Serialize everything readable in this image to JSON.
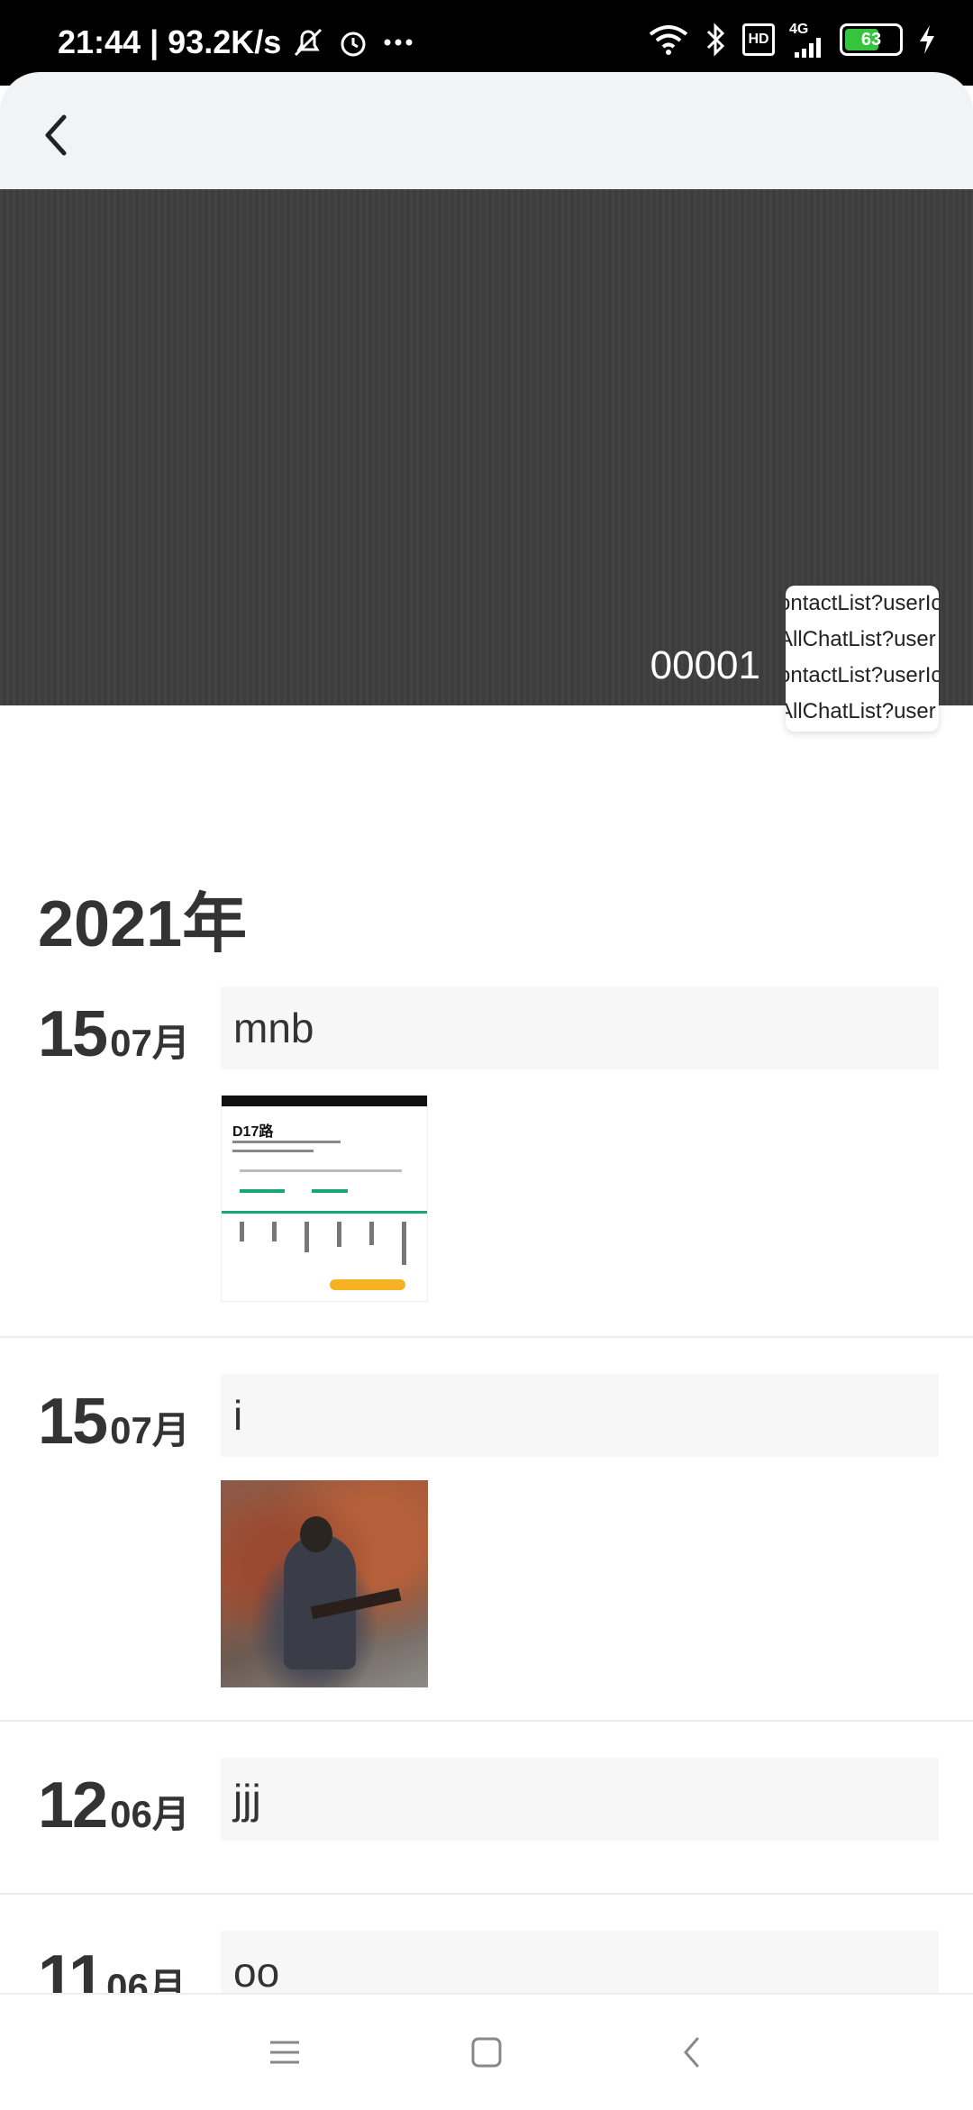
{
  "status_bar": {
    "time": "21:44",
    "speed": "93.2K/s",
    "network": "4G",
    "hd": "HD",
    "battery": "63",
    "battery_level": 0.63
  },
  "profile": {
    "username": "00001",
    "popup_items": [
      "ontactList?userIc",
      "AllChatList?user",
      "ontactList?userIc",
      "AllChatList?user"
    ]
  },
  "timeline": {
    "year": "2021年",
    "entries": [
      {
        "day": "15",
        "month": "07月",
        "text": "mnb",
        "image": "app-screenshot",
        "thumb_title": "D17路"
      },
      {
        "day": "15",
        "month": "07月",
        "text": "i",
        "image": "painting"
      },
      {
        "day": "12",
        "month": "06月",
        "text": "jjj"
      },
      {
        "day": "11",
        "month": "06月",
        "text": "oo"
      }
    ]
  },
  "icons": {
    "back": "chevron-left-icon",
    "nav_menu": "menu-icon",
    "nav_home": "home-icon",
    "nav_back": "back-icon"
  }
}
